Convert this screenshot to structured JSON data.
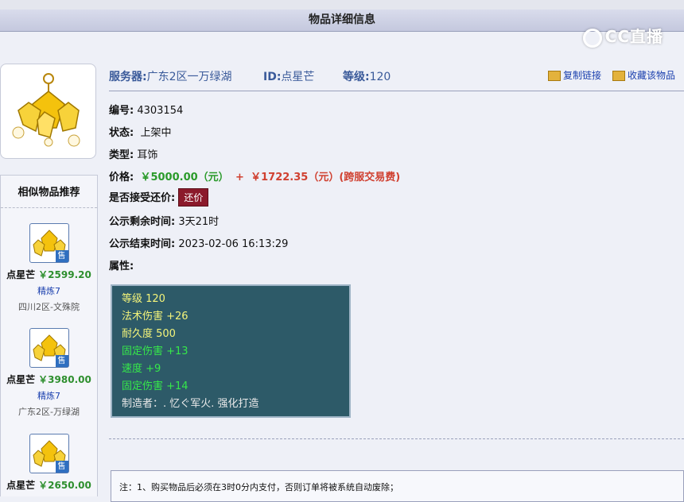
{
  "page": {
    "title": "物品详细信息",
    "watermark": "CC直播"
  },
  "item": {
    "server_label": "服务器:",
    "server_value": "广东2区一万绿湖",
    "id_label": "ID:",
    "id_value": "点星芒",
    "level_label": "等级:",
    "level_value": "120",
    "copy_link": "复制链接",
    "favorite": "收藏该物品",
    "serial_label": "编号:",
    "serial_value": "4303154",
    "status_label": "状态:",
    "status_value": "上架中",
    "type_label": "类型:",
    "type_value": "耳饰",
    "price_label": "价格:",
    "price_value": "￥5000.00（元）",
    "price_plus": "+",
    "price_extra": "￥1722.35（元）(跨服交易费)",
    "bargain_label": "是否接受还价:",
    "bargain_button": "还价",
    "remaining_label": "公示剩余时间:",
    "remaining_value": "3天21时",
    "end_label": "公示结束时间:",
    "end_value": "2023-02-06 16:13:29",
    "attr_label": "属性:"
  },
  "attributes": [
    "等级 120",
    "法术伤害 +26",
    "耐久度 500",
    "固定伤害 +13",
    "速度 +9",
    "固定伤害 +14",
    "制造者：. 忆ぐ军火. 强化打造"
  ],
  "sidebar": {
    "header": "相似物品推荐",
    "items": [
      {
        "name": "点星芒",
        "price": "￥2599.20",
        "refine": "精炼7",
        "server": "四川2区-文殊院",
        "badge": "售"
      },
      {
        "name": "点星芒",
        "price": "￥3980.00",
        "refine": "精炼7",
        "server": "广东2区-万绿湖",
        "badge": "售"
      },
      {
        "name": "点星芒",
        "price": "￥2650.00",
        "refine": "",
        "server": "",
        "badge": "售"
      }
    ]
  },
  "note": "注：1、购买物品后必须在3时0分内支付，否则订单将被系统自动废除；",
  "colors": {
    "attr_bg": "#2d5a68",
    "price_green": "#2a9a2a",
    "price_red": "#d04030",
    "bargain_bg": "#8b1a2b"
  }
}
